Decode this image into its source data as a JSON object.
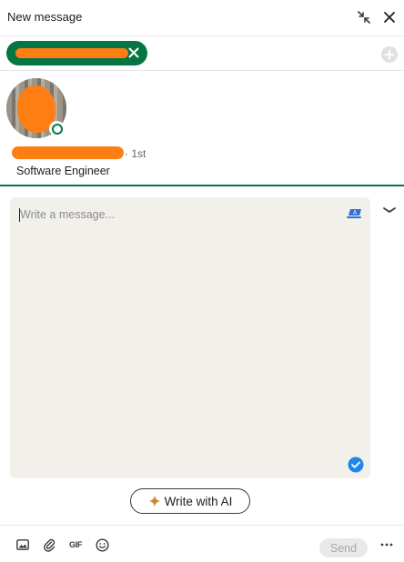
{
  "header": {
    "title": "New message"
  },
  "recipient": {
    "chip_color": "#057642"
  },
  "profile": {
    "degree": "· 1st",
    "headline": "Software Engineer"
  },
  "compose": {
    "placeholder": "Write a message..."
  },
  "ai": {
    "label": "Write with AI"
  },
  "footer": {
    "gif_label": "GIF",
    "send_label": "Send"
  },
  "colors": {
    "accent": "#057642",
    "redaction": "#ff7e13",
    "compose_bg": "#f2f0eb"
  }
}
